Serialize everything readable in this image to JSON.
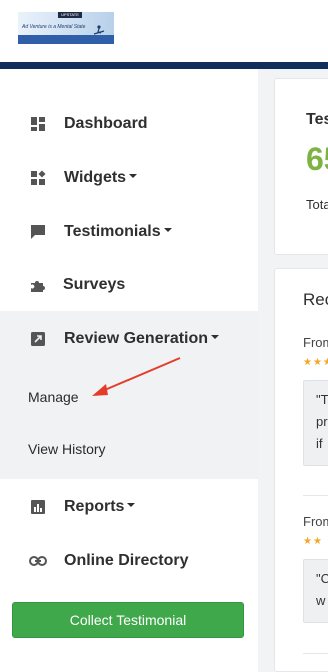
{
  "header": {
    "logo_badge": "UPSTATE",
    "logo_tagline": "Ad Venture is a Mental State"
  },
  "sidebar": {
    "items": [
      {
        "label": "Dashboard",
        "icon": "dashboard-icon",
        "has_caret": false
      },
      {
        "label": "Widgets",
        "icon": "widgets-icon",
        "has_caret": true
      },
      {
        "label": "Testimonials",
        "icon": "chat-icon",
        "has_caret": true
      },
      {
        "label": "Surveys",
        "icon": "puzzle-icon",
        "has_caret": false
      },
      {
        "label": "Review Generation",
        "icon": "external-link-icon",
        "has_caret": true
      },
      {
        "label": "Reports",
        "icon": "bar-chart-icon",
        "has_caret": true
      },
      {
        "label": "Online Directory",
        "icon": "link-icon",
        "has_caret": false
      }
    ],
    "review_generation_submenu": [
      "Manage",
      "View History"
    ],
    "collect_button": "Collect Testimonial"
  },
  "main": {
    "stat_card": {
      "title": "Tes",
      "value": "65",
      "subtitle": "Tota"
    },
    "recent_card": {
      "title": "Rec",
      "reviews": [
        {
          "from": "From",
          "stars": "★★★",
          "quote": "\"T\npr\nif"
        },
        {
          "from": "From",
          "stars": "★★",
          "quote": "\"C\nw"
        }
      ]
    }
  },
  "colors": {
    "topbar": "#0f2e5b",
    "accent_green": "#3fa84b",
    "stat_green": "#7cb342",
    "star": "#f5a623",
    "annotation_arrow": "#e53b2b"
  }
}
